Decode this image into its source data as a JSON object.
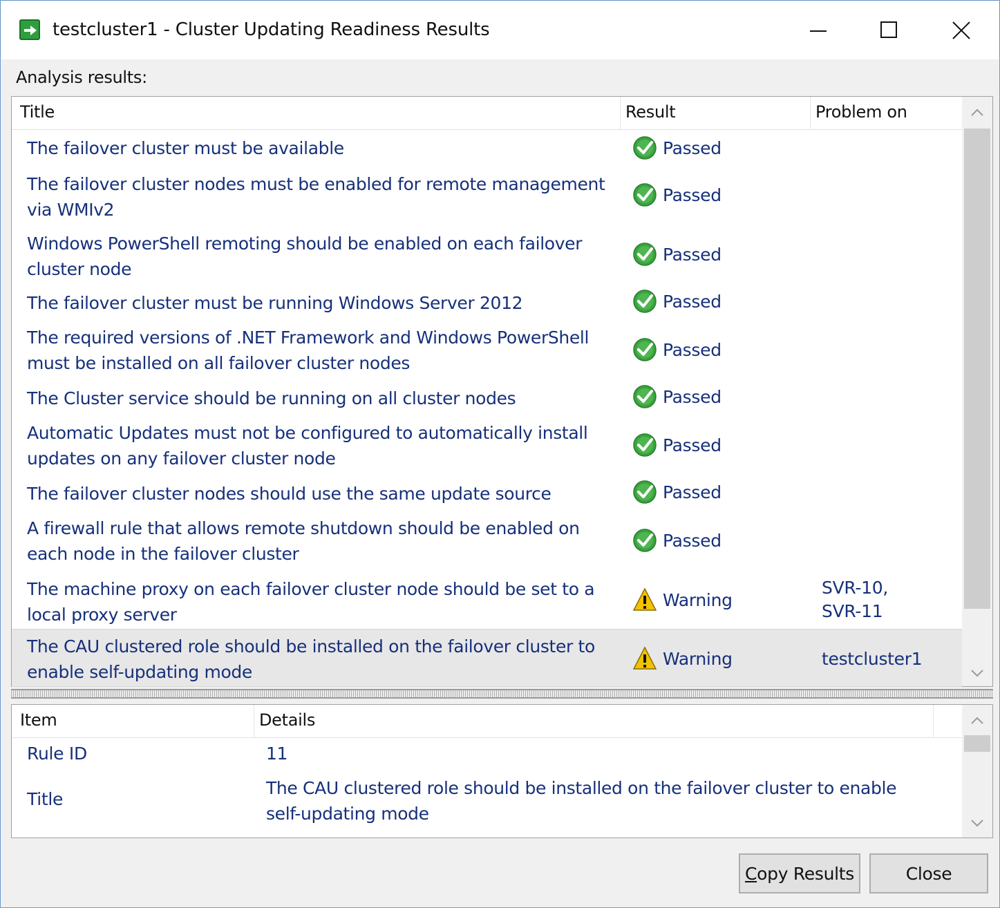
{
  "window": {
    "title": "testcluster1 - Cluster Updating Readiness Results",
    "accent": "#2f9e3f",
    "border": "#6a9ad0"
  },
  "analysis_label": "Analysis results:",
  "results": {
    "columns": {
      "title": "Title",
      "result": "Result",
      "problem_on": "Problem on"
    },
    "rows": [
      {
        "title": "The failover cluster must be available",
        "result": "Passed",
        "status_icon": "passed-check-icon",
        "problem_on": ""
      },
      {
        "title": "The failover cluster nodes must be enabled for remote management via WMIv2",
        "result": "Passed",
        "status_icon": "passed-check-icon",
        "problem_on": ""
      },
      {
        "title": "Windows PowerShell remoting should be enabled on each failover cluster node",
        "result": "Passed",
        "status_icon": "passed-check-icon",
        "problem_on": ""
      },
      {
        "title": "The failover cluster must be running Windows Server 2012",
        "result": "Passed",
        "status_icon": "passed-check-icon",
        "problem_on": ""
      },
      {
        "title": "The required versions of .NET Framework and Windows PowerShell must be installed on all failover cluster nodes",
        "result": "Passed",
        "status_icon": "passed-check-icon",
        "problem_on": ""
      },
      {
        "title": "The Cluster service should be running on all cluster nodes",
        "result": "Passed",
        "status_icon": "passed-check-icon",
        "problem_on": ""
      },
      {
        "title": "Automatic Updates must not be configured to automatically install updates on any failover cluster node",
        "result": "Passed",
        "status_icon": "passed-check-icon",
        "problem_on": ""
      },
      {
        "title": "The failover cluster nodes should use the same update source",
        "result": "Passed",
        "status_icon": "passed-check-icon",
        "problem_on": ""
      },
      {
        "title": "A firewall rule that allows remote shutdown should be enabled on each node in the failover cluster",
        "result": "Passed",
        "status_icon": "passed-check-icon",
        "problem_on": ""
      },
      {
        "title": "The machine proxy on each failover cluster node should be set to a local proxy server",
        "result": "Warning",
        "status_icon": "warning-triangle-icon",
        "problem_on": "SVR-10,\nSVR-11"
      },
      {
        "title": "The CAU clustered role should be installed on the failover cluster to enable self-updating mode",
        "result": "Warning",
        "status_icon": "warning-triangle-icon",
        "problem_on": "testcluster1",
        "selected": true
      }
    ]
  },
  "details": {
    "columns": {
      "item": "Item",
      "details": "Details"
    },
    "rows": [
      {
        "item": "Rule ID",
        "details": "11"
      },
      {
        "item": "Title",
        "details": "The CAU clustered role should be installed on the failover cluster to enable self-updating mode"
      }
    ]
  },
  "buttons": {
    "copy_mnemonic": "C",
    "copy_rest": "opy Results",
    "close": "Close"
  },
  "colors": {
    "link_text": "#16307a",
    "passed": "#3aa33f",
    "warning": "#f2c200",
    "selected_row": "#e7e7e7"
  }
}
